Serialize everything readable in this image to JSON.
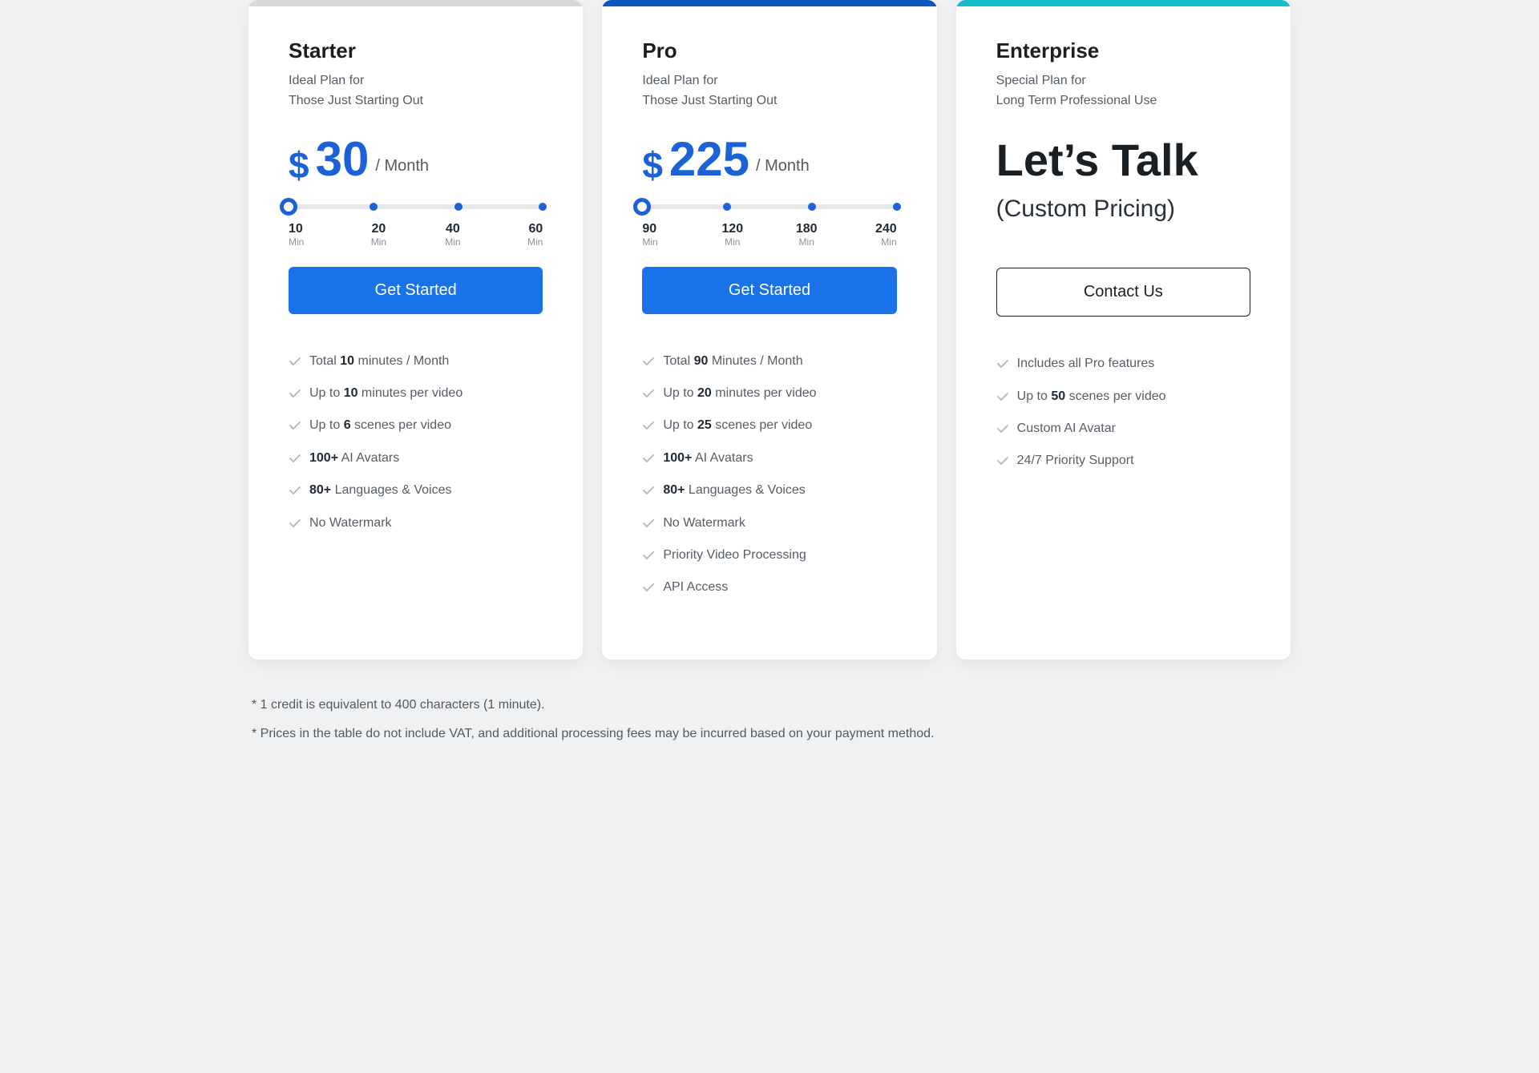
{
  "plans": {
    "starter": {
      "name": "Starter",
      "subtitle": "Ideal Plan for\nThose Just Starting Out",
      "currency": "$",
      "price": "30",
      "period": "/ Month",
      "slider": {
        "ticks": [
          {
            "val": "10",
            "unit": "Min"
          },
          {
            "val": "20",
            "unit": "Min"
          },
          {
            "val": "40",
            "unit": "Min"
          },
          {
            "val": "60",
            "unit": "Min"
          }
        ]
      },
      "cta": "Get Started",
      "features": [
        "Total <b>10</b> minutes / Month",
        "Up to <b>10</b> minutes per video",
        "Up to <b>6</b> scenes per video",
        "<b>100+</b> AI Avatars",
        "<b>80+</b> Languages & Voices",
        "No Watermark"
      ]
    },
    "pro": {
      "name": "Pro",
      "subtitle": "Ideal Plan for\nThose Just Starting Out",
      "currency": "$",
      "price": "225",
      "period": "/ Month",
      "slider": {
        "ticks": [
          {
            "val": "90",
            "unit": "Min"
          },
          {
            "val": "120",
            "unit": "Min"
          },
          {
            "val": "180",
            "unit": "Min"
          },
          {
            "val": "240",
            "unit": "Min"
          }
        ]
      },
      "cta": "Get Started",
      "features": [
        "Total <b>90</b> Minutes / Month",
        "Up to <b>20</b> minutes per video",
        "Up to <b>25</b> scenes per video",
        "<b>100+</b> AI Avatars",
        "<b>80+</b> Languages & Voices",
        "No Watermark",
        "Priority Video Processing",
        "API Access"
      ]
    },
    "enterprise": {
      "name": "Enterprise",
      "subtitle": "Special Plan for\nLong Term Professional Use",
      "headline": "Let’s Talk",
      "sub_headline": "(Custom Pricing)",
      "cta": "Contact Us",
      "features": [
        "Includes all Pro features",
        "Up to <b>50</b> scenes per video",
        "Custom AI Avatar",
        "24/7 Priority Support"
      ]
    }
  },
  "footnotes": [
    "* 1 credit is equivalent to 400 characters (1 minute).",
    "* Prices in the table do not include VAT, and additional processing fees may be incurred based on your payment method."
  ]
}
